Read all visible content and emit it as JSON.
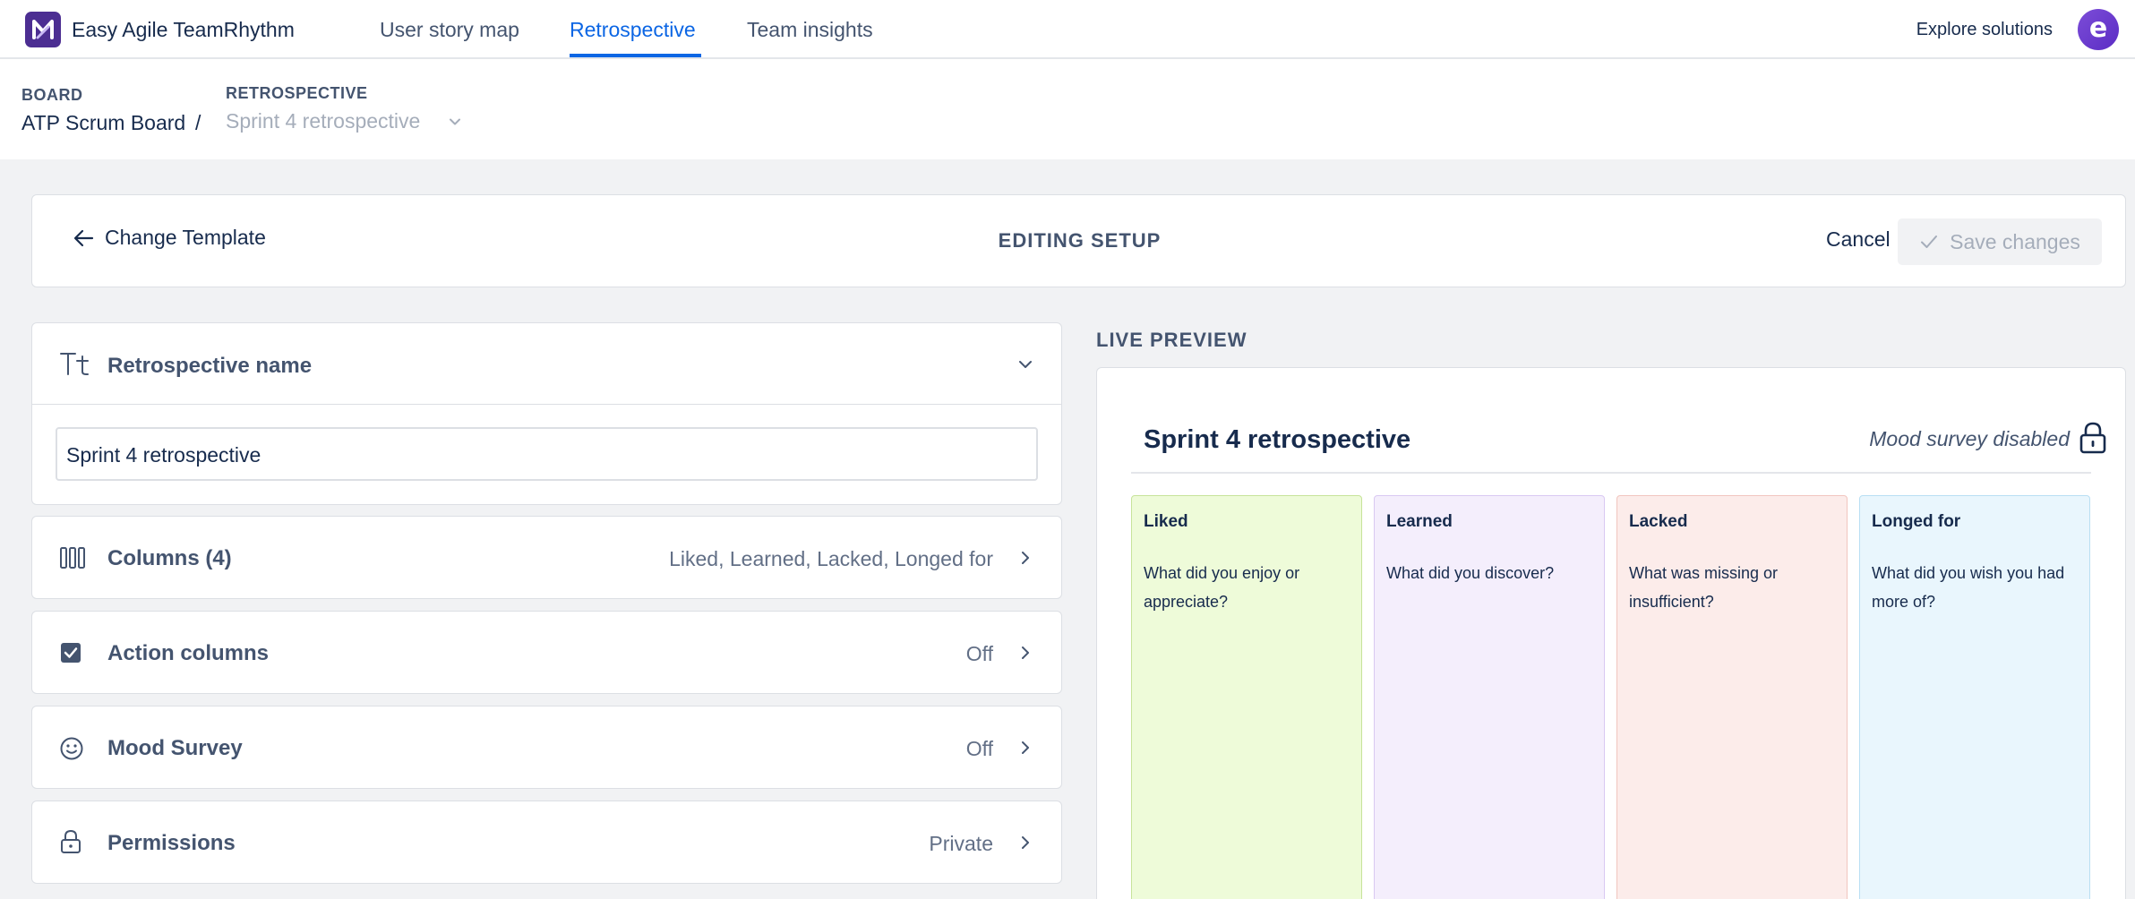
{
  "app": {
    "name": "Easy Agile TeamRhythm"
  },
  "nav": {
    "tabs": [
      {
        "label": "User story map"
      },
      {
        "label": "Retrospective",
        "active": true
      },
      {
        "label": "Team insights"
      }
    ],
    "explore_label": "Explore solutions",
    "avatar_letter": "e"
  },
  "breadcrumb": {
    "board_label": "BOARD",
    "board_value": "ATP Scrum Board",
    "separator": "/",
    "retro_label": "RETROSPECTIVE",
    "retro_value": "Sprint 4 retrospective"
  },
  "edit_header": {
    "back_label": "Change Template",
    "title": "EDITING SETUP",
    "cancel_label": "Cancel",
    "save_label": "Save changes"
  },
  "sections": {
    "name": {
      "title": "Retrospective name",
      "input_value": "Sprint 4 retrospective"
    },
    "columns": {
      "title": "Columns (4)",
      "value": "Liked, Learned, Lacked, Longed for"
    },
    "action_columns": {
      "title": "Action columns",
      "value": "Off"
    },
    "mood_survey": {
      "title": "Mood Survey",
      "value": "Off"
    },
    "permissions": {
      "title": "Permissions",
      "value": "Private"
    }
  },
  "preview": {
    "label": "LIVE PREVIEW",
    "title": "Sprint 4 retrospective",
    "mood_status": "Mood survey disabled",
    "columns": [
      {
        "title": "Liked",
        "description": "What did you enjoy or appreciate?",
        "bg": "#eefbd9",
        "border": "#c7e39a"
      },
      {
        "title": "Learned",
        "description": "What did you discover?",
        "bg": "#f4eefc",
        "border": "#d9c9f2"
      },
      {
        "title": "Lacked",
        "description": "What was missing or insufficient?",
        "bg": "#fcecea",
        "border": "#f1c5bf"
      },
      {
        "title": "Longed for",
        "description": "What did you wish you had more of?",
        "bg": "#e9f6fd",
        "border": "#b9dff3"
      }
    ]
  },
  "colors": {
    "accent": "#0c66e4",
    "brand": "#4c2e92",
    "text": "#172b4d",
    "muted": "#44546f"
  },
  "icons": {
    "logo": "easy-agile-logo",
    "back": "arrow-left-icon",
    "save": "check-icon",
    "name": "text-style-icon",
    "columns": "columns-icon",
    "action_columns": "checkbox-icon",
    "mood_survey": "smiley-icon",
    "permissions": "lock-icon",
    "preview_lock": "lock-icon"
  }
}
